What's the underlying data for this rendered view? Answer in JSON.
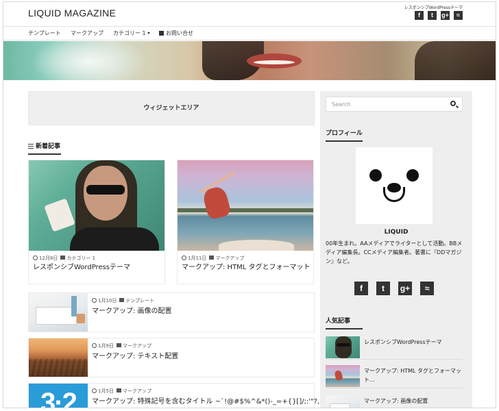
{
  "header": {
    "logo": "LIQUID MAGAZINE",
    "tagline": "レスポンシブWordPressテーマ",
    "social": [
      {
        "icon": "facebook-icon",
        "glyph": "f"
      },
      {
        "icon": "twitter-icon",
        "glyph": "t"
      },
      {
        "icon": "google-plus-icon",
        "glyph": "g+"
      },
      {
        "icon": "rss-icon",
        "glyph": "≈"
      }
    ]
  },
  "nav": {
    "items": [
      {
        "label": "テンプレート"
      },
      {
        "label": "マークアップ"
      },
      {
        "label": "カテゴリー 1"
      },
      {
        "label": "お問い合せ"
      }
    ]
  },
  "main": {
    "widget_area": "ウィジェットエリア",
    "section_title": "新着記事",
    "cards": [
      {
        "date": "12月8日",
        "category": "カテゴリー 1",
        "title": "レスポンシブWordPressテーマ"
      },
      {
        "date": "1月11日",
        "category": "マークアップ",
        "title": "マークアップ: HTML タグとフォーマット"
      }
    ],
    "rows": [
      {
        "date": "1月10日",
        "category": "テンプレート",
        "title": "マークアップ: 画像の配置",
        "thumb_text": ""
      },
      {
        "date": "1月9日",
        "category": "マークアップ",
        "title": "マークアップ: テキスト配置",
        "thumb_text": ""
      },
      {
        "date": "1月5日",
        "category": "マークアップ",
        "title": "マークアップ: 特殊記号を含むタイトル ~`!@#$%^&*()-_=+{}[]/;:'\"?,.>",
        "thumb_text": "3·2"
      }
    ]
  },
  "sidebar": {
    "search_placeholder": "Search",
    "profile_title": "プロフィール",
    "profile_name": "LIQUID",
    "profile_desc": "00年生まれ。AAメディアでライターとして活動。BBメディア編集長。CCメディア編集者。著書に『DDマガジン』など。",
    "social": [
      {
        "icon": "facebook-icon",
        "glyph": "f"
      },
      {
        "icon": "twitter-icon",
        "glyph": "t"
      },
      {
        "icon": "google-plus-icon",
        "glyph": "g+"
      },
      {
        "icon": "rss-icon",
        "glyph": "≈"
      }
    ],
    "popular_title": "人気記事",
    "popular": [
      {
        "title": "レスポンシブWordPressテーマ"
      },
      {
        "title": "マークアップ: HTML タグとフォーマット..."
      },
      {
        "title": "マークアップ: 画像の配置"
      }
    ]
  }
}
